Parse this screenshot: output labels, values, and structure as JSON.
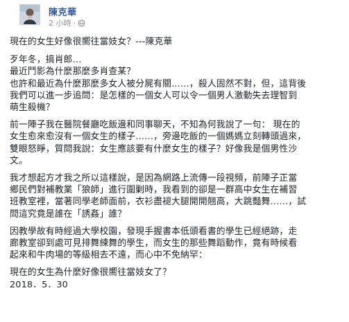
{
  "post": {
    "author": "陳克華",
    "timestamp": "2 小時",
    "title": "現在的女生好像很嚮往當妓女？---陳克華",
    "paragraphs": [
      [
        "歹年冬，搞肖郎…",
        "最近鬥影為什麼那麼多肖查某？"
      ],
      [
        "也許和最近為什麼那麼多女人被分屍有關……，殺人固然不對，但，這背後",
        "我們可以進一步追問：是怎樣的一個女人可以令一個男人激動失去理智到",
        "萌生殺機？"
      ],
      [
        "前一陣子我在醫院餐廳吃飯邊和同事聊天，不知為何我說了一句：  現在的",
        "女生愈來愈沒有一個女生的樣子……，旁邊吃飯的一個媽媽立刻轉頭過來，",
        "雙眼怒睜，質問我說：女生應該要有什麼女生的樣子？好像我是個男性沙",
        "文。"
      ],
      [
        "我才想起方才我之所以這樣說，是因為網路上流傳一段視頻，前陣子正當",
        "鄉民們對補教業「狼師」進行圍剿時，我看到的卻是一群高中女生在補習",
        "班教室裡，當著同學老師面前，衣衫盡褪大腿開開翹高，大跳豔舞……，試",
        "問這究竟是誰在「誘姦」誰？"
      ],
      [
        "因教學故有時經過大學校園，發現手握書本低頭看書的學生已經絕跡，走",
        "廊教室卻到處可見排舞練舞的學生，而女生的那些舞蹈動作，竟有時候看",
        "起來和牛肉場的等級相去不遠，而心中不免納罕："
      ],
      [
        "現在的女生為什麼好像很嚮往當妓女了？",
        "2018．5．30"
      ]
    ]
  }
}
